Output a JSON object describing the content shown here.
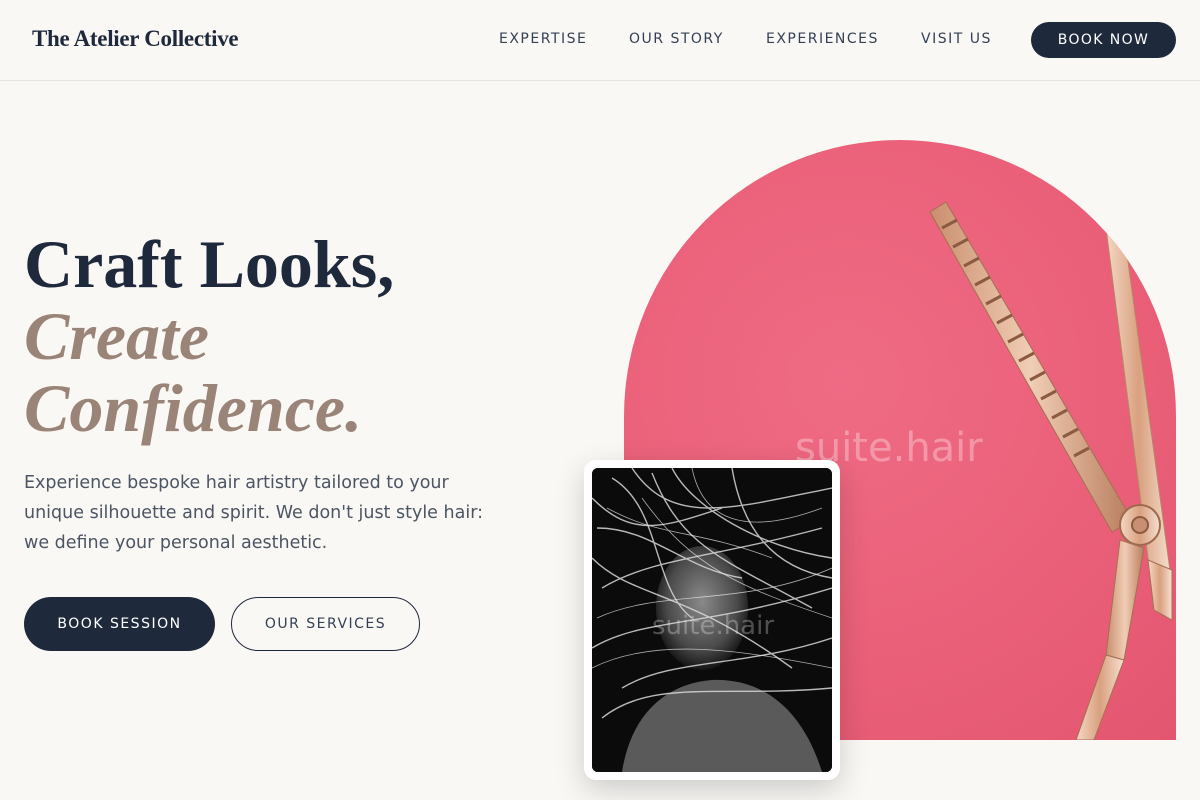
{
  "header": {
    "logo": "The Atelier Collective",
    "nav": [
      {
        "label": "EXPERTISE"
      },
      {
        "label": "OUR STORY"
      },
      {
        "label": "EXPERIENCES"
      },
      {
        "label": "VISIT US"
      }
    ],
    "cta_label": "BOOK NOW"
  },
  "hero": {
    "headline_line1": "Craft Looks,",
    "headline_line2": "Create",
    "headline_line3": "Confidence.",
    "description": "Experience bespoke hair artistry tailored to your unique silhouette and spirit. We don't just style hair: we define your personal aesthetic.",
    "primary_button": "BOOK SESSION",
    "secondary_button": "OUR SERVICES"
  },
  "images": {
    "arch_watermark": "suite.hair",
    "portrait_watermark": "suite.hair"
  },
  "colors": {
    "navy": "#1e293b",
    "accent_taupe": "#9a8478",
    "background": "#faf8f5",
    "arch_pink": "#ea5f78"
  }
}
